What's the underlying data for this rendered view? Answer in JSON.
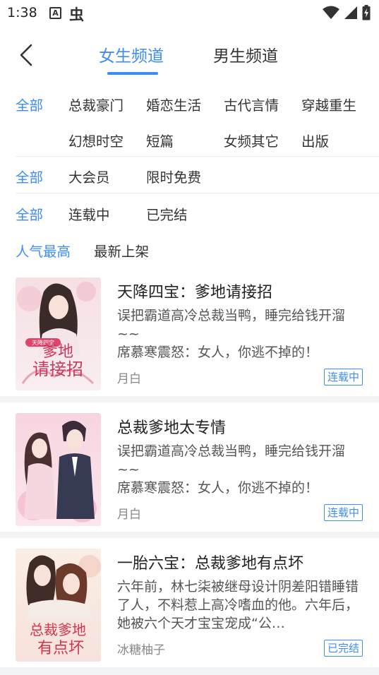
{
  "status_bar": {
    "time": "1:38",
    "app_icon_a": "A",
    "app_icon_bug": "虫"
  },
  "header": {
    "tabs": [
      {
        "label": "女生频道",
        "active": true
      },
      {
        "label": "男生频道",
        "active": false
      }
    ]
  },
  "filters": {
    "category": {
      "all": "全部",
      "items": [
        "总裁豪门",
        "婚恋生活",
        "古代言情",
        "穿越重生",
        "幻想时空",
        "短篇",
        "女频其它",
        "出版"
      ]
    },
    "membership": {
      "all": "全部",
      "items": [
        "大会员",
        "限时免费"
      ]
    },
    "status": {
      "all": "全部",
      "items": [
        "连载中",
        "已完结"
      ]
    },
    "sort": {
      "items": [
        "人气最高",
        "最新上架"
      ]
    }
  },
  "books": [
    {
      "title": "天降四宝：爹地请接招",
      "desc": "误把霸道高冷总裁当鸭，睡完给钱开溜~~\n席慕寒震怒：女人，你逃不掉的！",
      "author": "月白",
      "status": "连载中",
      "cover_text": "天降四宝 爹地请接招"
    },
    {
      "title": "总裁爹地太专情",
      "desc": "误把霸道高冷总裁当鸭，睡完给钱开溜~~\n席慕寒震怒：女人，你逃不掉的！",
      "author": "月白",
      "status": "连载中"
    },
    {
      "title": "一胎六宝：总裁爹地有点坏",
      "desc": "六年前，林七柒被继母设计阴差阳错睡错了人，不料惹上高冷嗜血的他。六年后，她被六个天才宝宝宠成“公…",
      "author": "冰糖柚子",
      "status": "已完结",
      "cover_text": "总裁爹地 有点坏"
    }
  ],
  "colors": {
    "accent": "#3f8cf4",
    "background": "#f2f3f5"
  }
}
